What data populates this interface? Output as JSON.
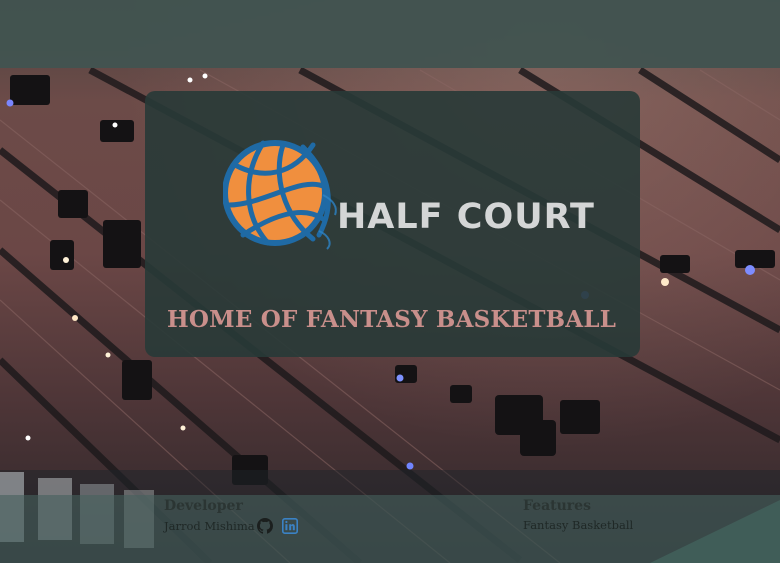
{
  "hero": {
    "logo_text": "HALF COURT",
    "tagline": "HOME OF FANTASY BASKETBALL"
  },
  "footer": {
    "developer": {
      "heading": "Developer",
      "name": "Jarrod Mishima",
      "icons": [
        "github-icon",
        "linkedin-icon"
      ]
    },
    "features": {
      "heading": "Features",
      "items": [
        "Fantasy Basketball"
      ]
    }
  },
  "colors": {
    "header_strip": "#425350",
    "card": "#283a37",
    "tagline": "#c98f8b",
    "logo_text": "#d4d6d6",
    "ball_orange": "#f08f3e",
    "ball_lines": "#1f6aa5",
    "github": "#1b1f1e",
    "linkedin": "#3b82c4"
  }
}
